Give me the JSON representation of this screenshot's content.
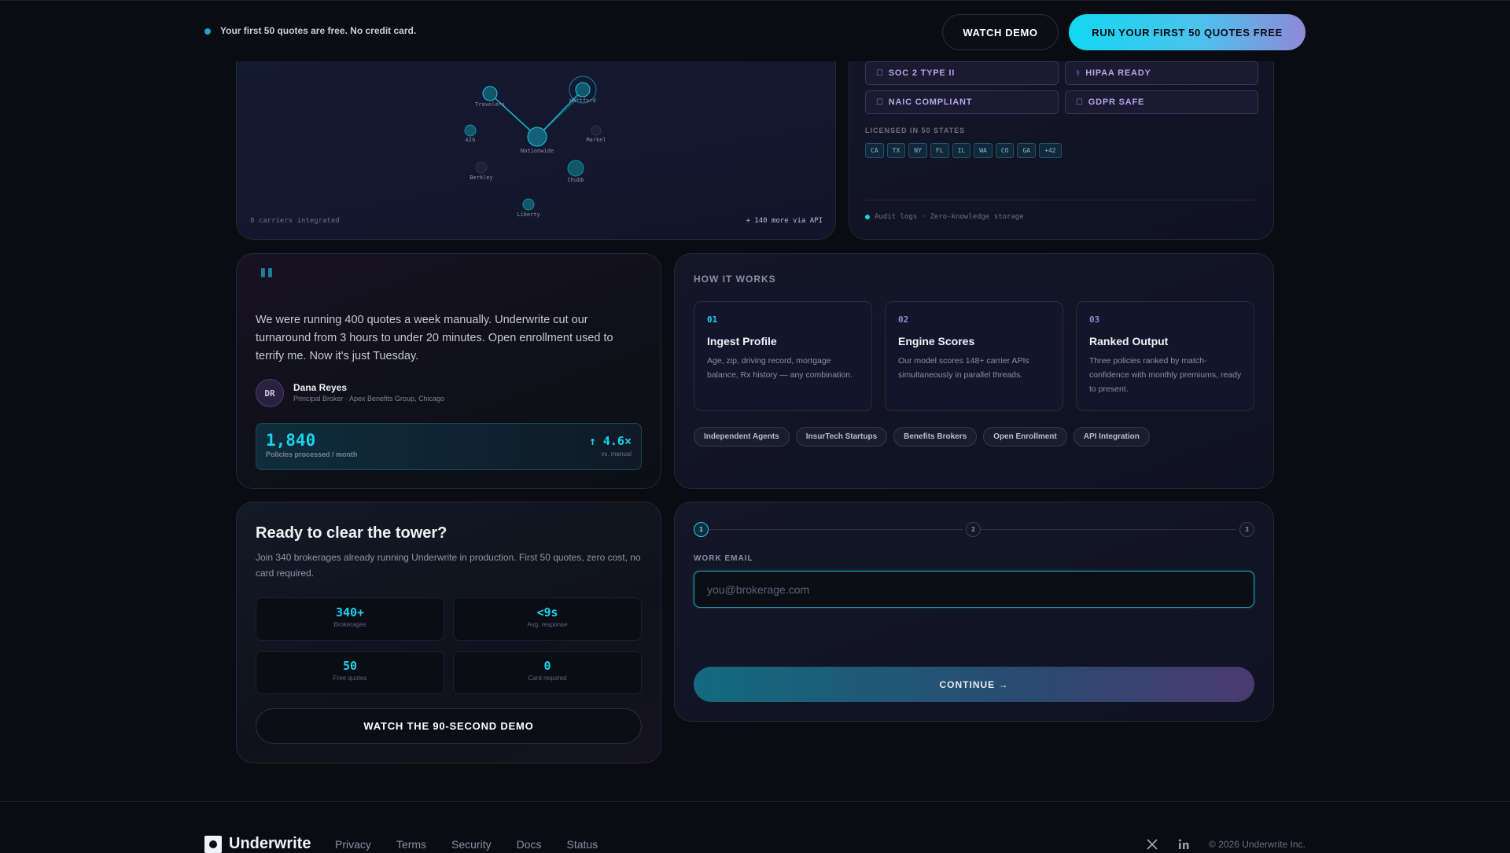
{
  "topbar": {
    "promo": "Your first 50 quotes are free. No credit card.",
    "watch_demo": "WATCH DEMO",
    "run_quotes": "RUN YOUR FIRST 50 QUOTES FREE"
  },
  "network": {
    "carriers": [
      {
        "name": "Travelers"
      },
      {
        "name": "Hartford"
      },
      {
        "name": "AIG"
      },
      {
        "name": "Nationwide"
      },
      {
        "name": "Markel"
      },
      {
        "name": "Berkley"
      },
      {
        "name": "Chubb"
      },
      {
        "name": "Liberty"
      }
    ],
    "footer_left": "8 carriers integrated",
    "footer_right": "+ 140 more via API"
  },
  "compliance": {
    "badges": [
      {
        "icon": "check-square-icon",
        "glyph": "☐",
        "label": "SOC 2 TYPE II"
      },
      {
        "icon": "medical-icon",
        "glyph": "⚕",
        "label": "HIPAA READY"
      },
      {
        "icon": "check-square-icon",
        "glyph": "☐",
        "label": "NAIC COMPLIANT"
      },
      {
        "icon": "check-square-icon",
        "glyph": "☐",
        "label": "GDPR SAFE"
      }
    ],
    "licensed_label": "LICENSED IN 50 STATES",
    "states": [
      "CA",
      "TX",
      "NY",
      "FL",
      "IL",
      "WA",
      "CO",
      "GA",
      "+42"
    ],
    "audit": "Audit logs · Zero-knowledge storage"
  },
  "testimonial": {
    "quote_glyph": "\"",
    "text": "We were running 400 quotes a week manually. Underwrite cut our turnaround from 3 hours to under 20 minutes. Open enrollment used to terrify me. Now it's just Tuesday.",
    "initials": "DR",
    "name": "Dana Reyes",
    "role": "Principal Broker · Apex Benefits Group, Chicago",
    "metric_value": "1,840",
    "metric_label": "Policies processed / month",
    "metric_multiplier": "↑ 4.6×",
    "metric_sub": "vs. manual"
  },
  "how": {
    "title": "HOW IT WORKS",
    "steps": [
      {
        "num": "01",
        "title": "Ingest Profile",
        "desc": "Age, zip, driving record, mortgage balance, Rx history — any combination."
      },
      {
        "num": "02",
        "title": "Engine Scores",
        "desc": "Our model scores 148+ carrier APIs simultaneously in parallel threads."
      },
      {
        "num": "03",
        "title": "Ranked Output",
        "desc": "Three policies ranked by match-confidence with monthly premiums, ready to present."
      }
    ],
    "tags": [
      "Independent Agents",
      "InsurTech Startups",
      "Benefits Brokers",
      "Open Enrollment",
      "API Integration"
    ]
  },
  "cta": {
    "title": "Ready to clear the tower?",
    "desc": "Join 340 brokerages already running Underwrite in production. First 50 quotes, zero cost, no card required.",
    "stats": [
      {
        "value": "340+",
        "label": "Brokerages"
      },
      {
        "value": "<9s",
        "label": "Avg. response"
      },
      {
        "value": "50",
        "label": "Free quotes"
      },
      {
        "value": "0",
        "label": "Card required"
      }
    ],
    "button": "WATCH THE 90-SECOND DEMO"
  },
  "form": {
    "steps": [
      "1",
      "2",
      "3"
    ],
    "current_step": 1,
    "email_label": "WORK EMAIL",
    "email_placeholder": "you@brokerage.com",
    "email_value": "",
    "continue": "CONTINUE →"
  },
  "footer": {
    "brand": "Underwrite",
    "links": [
      "Privacy",
      "Terms",
      "Security",
      "Docs",
      "Status"
    ],
    "copyright": "© 2026 Underwrite Inc."
  },
  "colors": {
    "accent": "#19d3ee",
    "violet": "#8f89d8",
    "background": "#0a0c12"
  }
}
